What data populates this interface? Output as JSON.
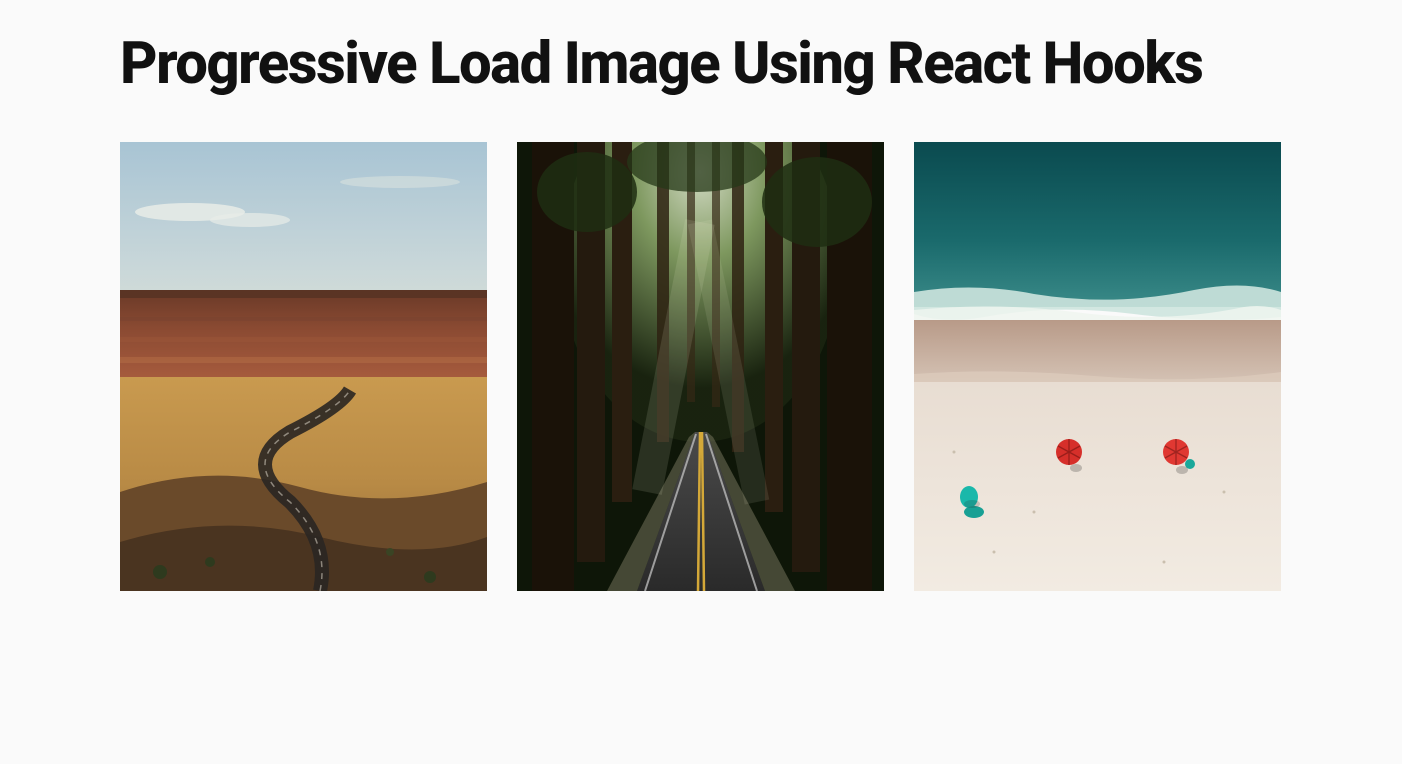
{
  "title": "Progressive Load Image Using React Hooks",
  "images": [
    {
      "alt": "desert-canyon-road"
    },
    {
      "alt": "redwood-forest-road"
    },
    {
      "alt": "aerial-beach-umbrellas"
    }
  ]
}
